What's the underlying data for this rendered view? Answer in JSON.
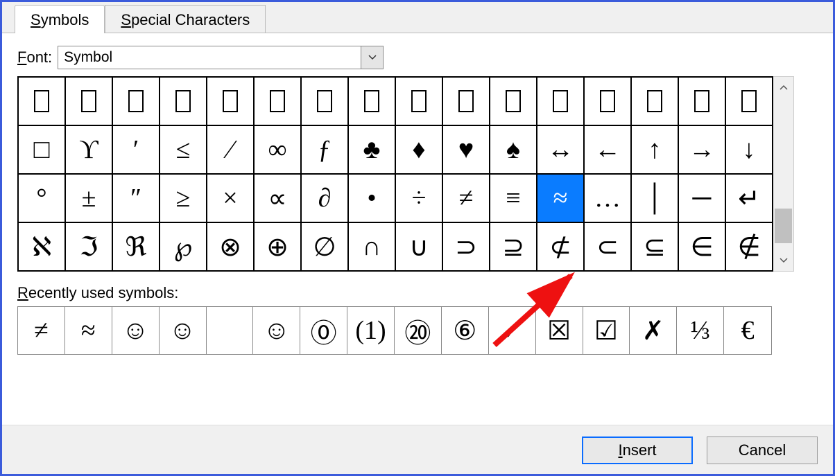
{
  "tabs": {
    "symbols": "Symbols",
    "special": "Special Characters"
  },
  "font": {
    "label": "Font:",
    "value": "Symbol"
  },
  "grid": {
    "rows": [
      [
        "",
        "",
        "",
        "",
        "",
        "",
        "",
        "",
        "",
        "",
        "",
        "",
        "",
        "",
        "",
        ""
      ],
      [
        "□",
        "ϒ",
        "′",
        "≤",
        "⁄",
        "∞",
        "ƒ",
        "♣",
        "♦",
        "♥",
        "♠",
        "↔",
        "←",
        "↑",
        "→",
        "↓"
      ],
      [
        "°",
        "±",
        "″",
        "≥",
        "×",
        "∝",
        "∂",
        "•",
        "÷",
        "≠",
        "≡",
        "≈",
        "…",
        "│",
        "─",
        "↵"
      ],
      [
        "ℵ",
        "ℑ",
        "ℜ",
        "℘",
        "⊗",
        "⊕",
        "∅",
        "∩",
        "∪",
        "⊃",
        "⊇",
        "⊄",
        "⊂",
        "⊆",
        "∈",
        "∉"
      ]
    ],
    "selected_row": 2,
    "selected_col": 11
  },
  "recent": {
    "label": "Recently used symbols:",
    "items": [
      "≠",
      "≈",
      "☺",
      "☺",
      "",
      "☺",
      "⓪",
      "(1)",
      "⑳",
      "⑥",
      "✓",
      "☒",
      "☑",
      "✗",
      "⅓",
      "€"
    ]
  },
  "buttons": {
    "insert": "Insert",
    "cancel": "Cancel"
  }
}
